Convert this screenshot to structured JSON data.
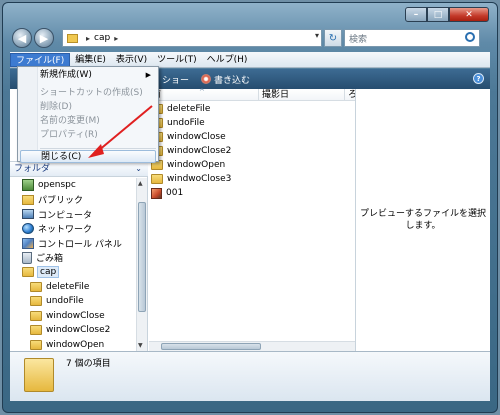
{
  "window": {
    "caption_buttons": {
      "minimize": "–",
      "maximize": "□",
      "close": "✕"
    }
  },
  "address": {
    "back_icon": "◀",
    "forward_icon": "▶",
    "path": "cap",
    "chevron": "▸",
    "dropdown": "▾",
    "refresh_icon": "↻",
    "search_placeholder": "検索"
  },
  "menubar": {
    "items": [
      "ファイル(F)",
      "編集(E)",
      "表示(V)",
      "ツール(T)",
      "ヘルプ(H)"
    ],
    "active_index": 0
  },
  "toolbar": {
    "view_label": "ショー",
    "burn_label": "書き込む",
    "help": "?"
  },
  "file_menu": {
    "items": [
      {
        "label": "新規作成(W)",
        "disabled": false,
        "submenu": true
      },
      {
        "label": "ショートカットの作成(S)",
        "disabled": true
      },
      {
        "label": "削除(D)",
        "disabled": true
      },
      {
        "label": "名前の変更(M)",
        "disabled": true
      },
      {
        "label": "プロパティ(R)",
        "disabled": true
      },
      {
        "label": "閉じる(C)",
        "disabled": false,
        "hover": true
      }
    ],
    "submenu_arrow": "▶"
  },
  "sidebar": {
    "folder_header": "フォルダ",
    "folder_header_chevron": "⌄",
    "tree": [
      {
        "label": "openspc",
        "icon": "user-icon",
        "indent": 0
      },
      {
        "label": "パブリック",
        "icon": "public-folder-icon",
        "indent": 0
      },
      {
        "label": "コンピュータ",
        "icon": "computer-icon",
        "indent": 0
      },
      {
        "label": "ネットワーク",
        "icon": "network-icon",
        "indent": 0
      },
      {
        "label": "コントロール パネル",
        "icon": "control-panel-icon",
        "indent": 0
      },
      {
        "label": "ごみ箱",
        "icon": "recycle-bin-icon",
        "indent": 0
      },
      {
        "label": "cap",
        "icon": "folder-icon",
        "indent": 0,
        "selected": true
      },
      {
        "label": "deleteFile",
        "icon": "folder-icon",
        "indent": 1
      },
      {
        "label": "undoFile",
        "icon": "folder-icon",
        "indent": 1
      },
      {
        "label": "windowClose",
        "icon": "folder-icon",
        "indent": 1
      },
      {
        "label": "windowClose2",
        "icon": "folder-icon",
        "indent": 1
      },
      {
        "label": "windowOpen",
        "icon": "folder-icon",
        "indent": 1
      },
      {
        "label": "windwoClose3",
        "icon": "folder-icon",
        "indent": 1
      }
    ]
  },
  "filelist": {
    "columns": {
      "name": "前",
      "date": "撮影日",
      "more": "ろ"
    },
    "sort_arrow": "^",
    "rows": [
      {
        "name": "deleteFile",
        "icon": "folder-icon"
      },
      {
        "name": "undoFile",
        "icon": "folder-icon"
      },
      {
        "name": "windowClose",
        "icon": "folder-icon"
      },
      {
        "name": "windowClose2",
        "icon": "folder-icon"
      },
      {
        "name": "windowOpen",
        "icon": "folder-icon"
      },
      {
        "name": "windwoClose3",
        "icon": "folder-icon"
      },
      {
        "name": "001",
        "icon": "image-file-icon"
      }
    ]
  },
  "preview": {
    "message": "プレビューするファイルを選択します。"
  },
  "details": {
    "item_count": "7 個の項目"
  },
  "colors": {
    "accent": "#3d7bd1",
    "annotation_arrow": "#e02020",
    "toolbar_bg": "#264d6f"
  }
}
